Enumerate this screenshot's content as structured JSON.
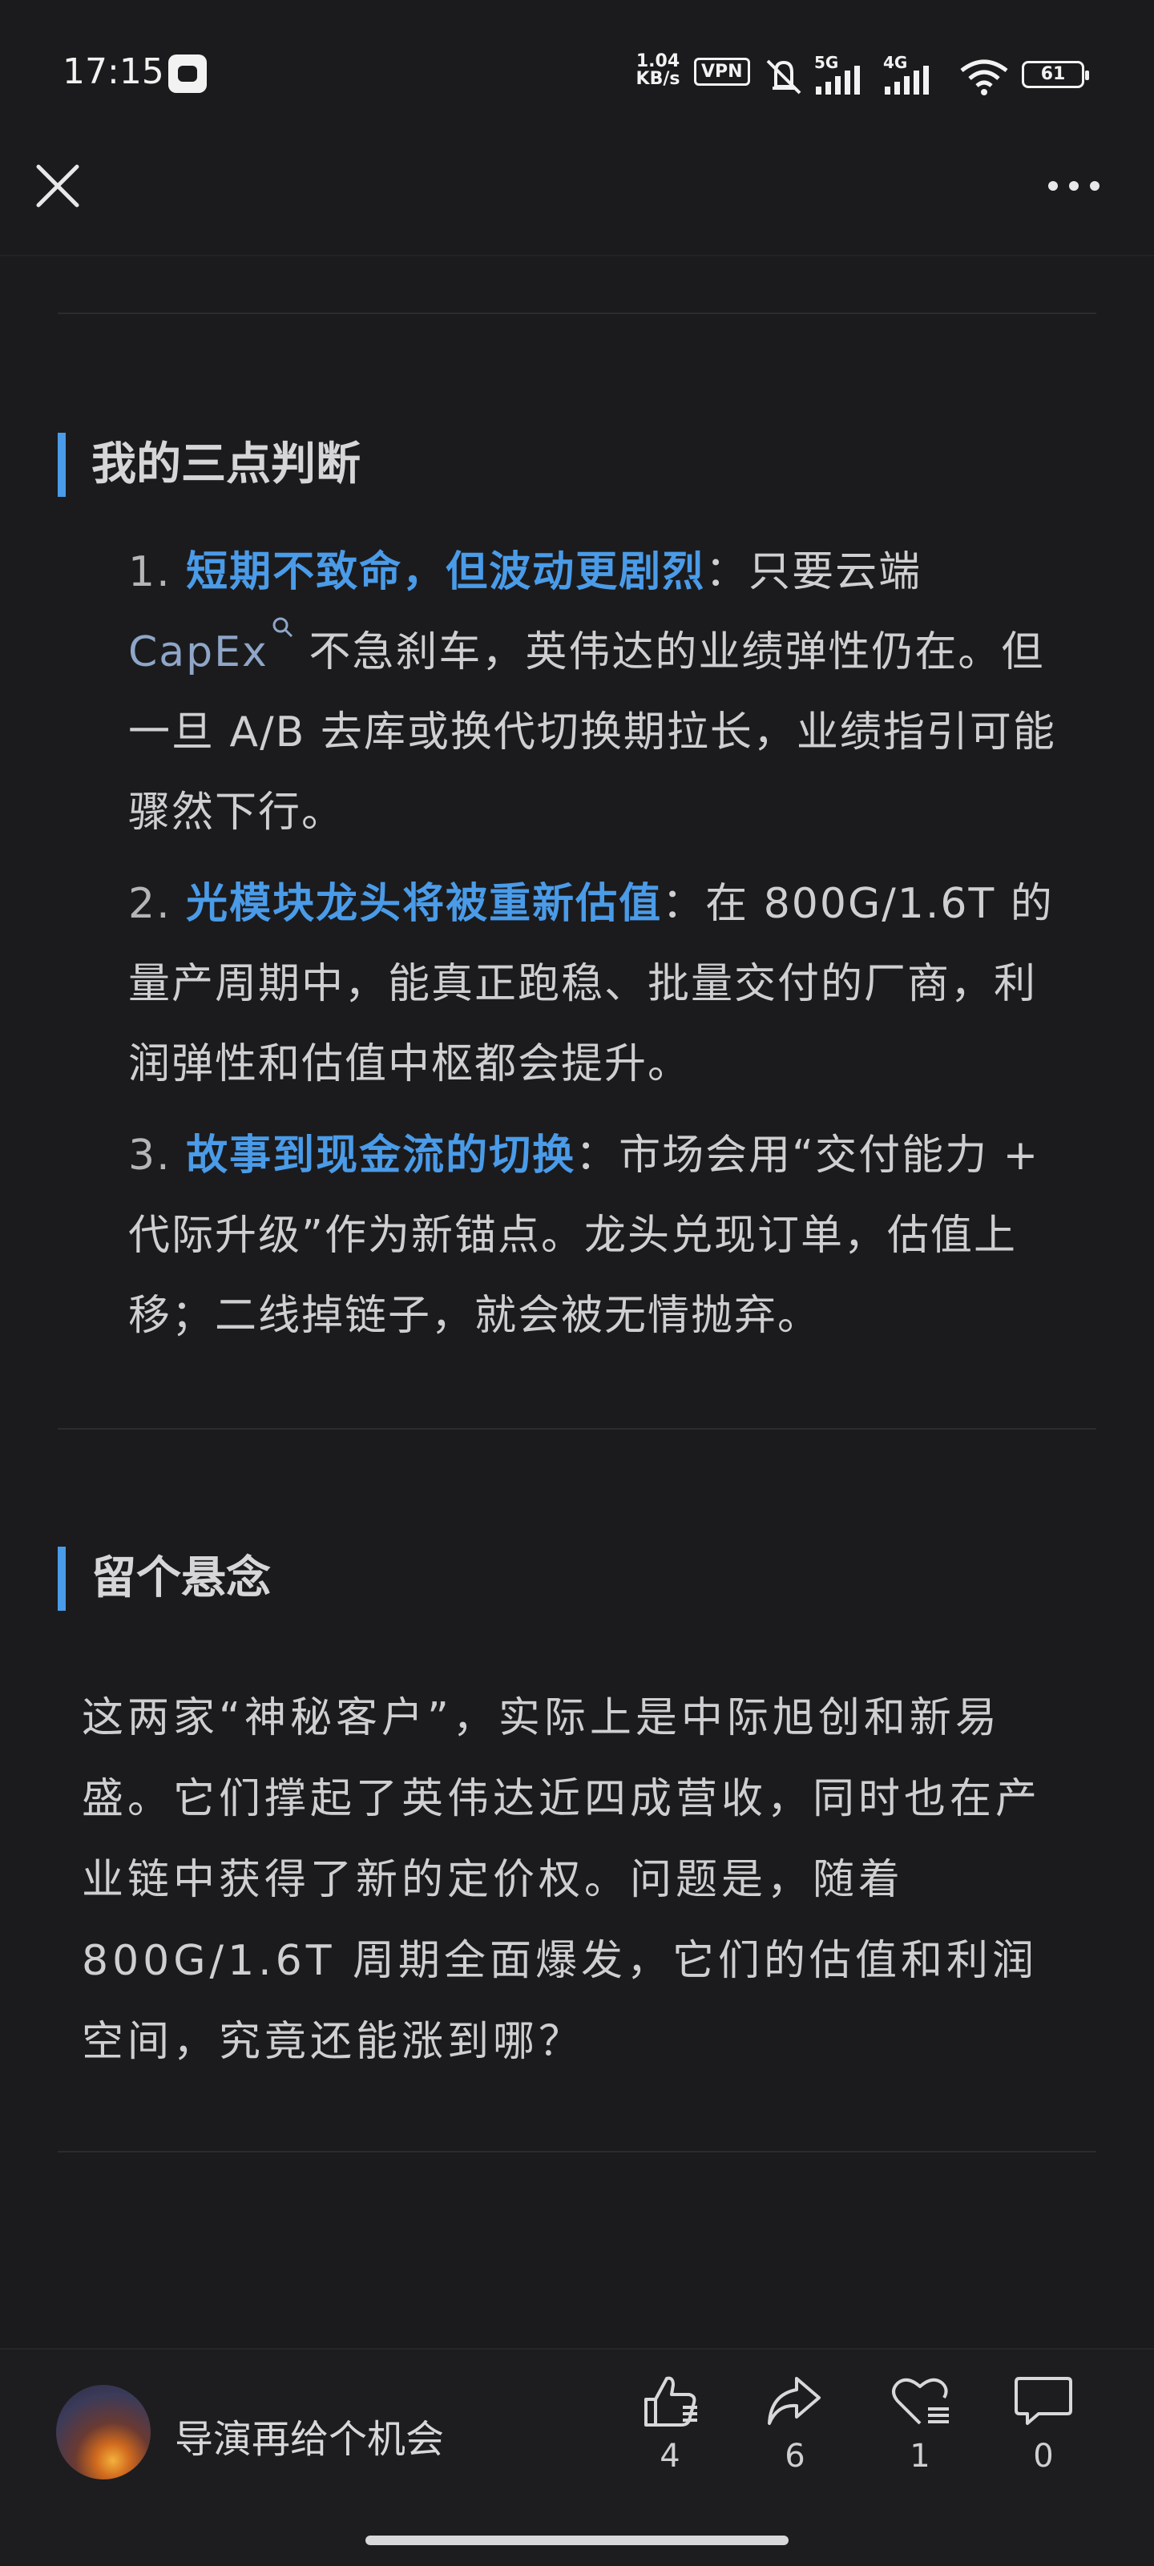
{
  "status_bar": {
    "time": "17:15",
    "net_speed_value": "1.04",
    "net_speed_unit": "KB/s",
    "vpn": "VPN",
    "signal_1": "5G",
    "signal_2": "4G",
    "battery": "61"
  },
  "icons": {
    "close": "close-icon",
    "more": "more-icon",
    "like": "thumbs-up-icon",
    "share": "share-icon",
    "favorite": "heart-icon",
    "comment": "comment-icon"
  },
  "section_judgment": {
    "title": "我的三点判断",
    "items": [
      {
        "num": "1.",
        "highlight": "短期不致命，但波动更剧烈",
        "text_before_link": "：只要云端",
        "link": "CapEx",
        "text_after_link": " 不急刹车，英伟达的业绩弹性仍在。但一旦 A/B 去库或换代切换期拉长，业绩指引可能骤然下行。"
      },
      {
        "num": "2.",
        "highlight": "光模块龙头将被重新估值",
        "text": "：在 800G/1.6T 的量产周期中，能真正跑稳、批量交付的厂商，利润弹性和估值中枢都会提升。"
      },
      {
        "num": "3.",
        "highlight": "故事到现金流的切换",
        "text": "：市场会用“交付能力 + 代际升级”作为新锚点。龙头兑现订单，估值上移；二线掉链子，就会被无情抛弃。"
      }
    ]
  },
  "section_suspense": {
    "title": "留个悬念",
    "paragraph": "这两家“神秘客户”，实际上是中际旭创和新易盛。它们撑起了英伟达近四成营收，同时也在产业链中获得了新的定价权。问题是，随着 800G/1.6T 周期全面爆发，它们的估值和利润空间，究竟还能涨到哪？"
  },
  "bottom_bar": {
    "author": "导演再给个机会",
    "like_count": "4",
    "share_count": "6",
    "favorite_count": "1",
    "comment_count": "0"
  },
  "colors": {
    "background": "#1b1b1d",
    "accent": "#4a9be8",
    "text": "#cfcfd2"
  }
}
